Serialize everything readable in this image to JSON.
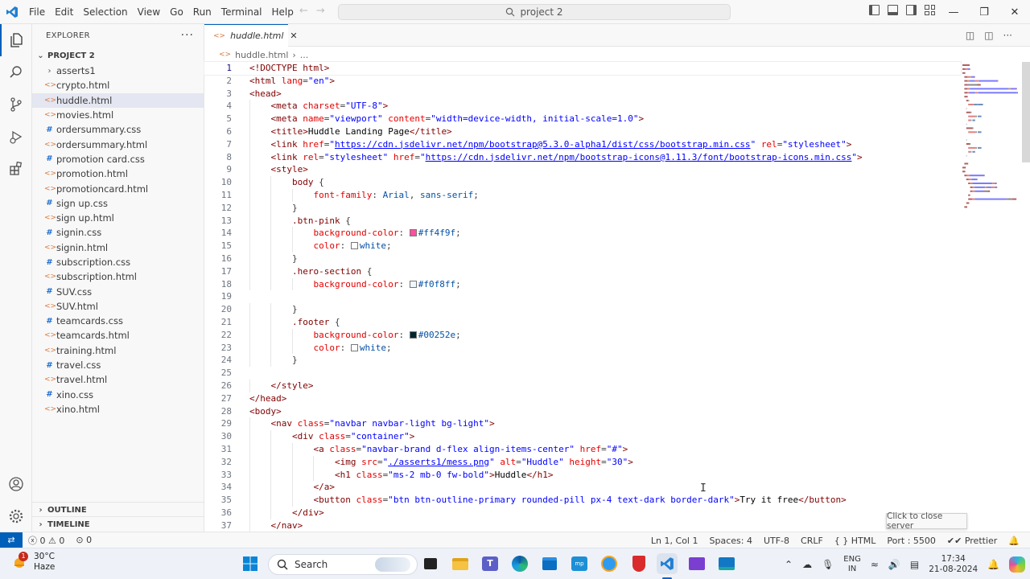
{
  "menu": [
    "File",
    "Edit",
    "Selection",
    "View",
    "Go",
    "Run",
    "Terminal",
    "Help"
  ],
  "command_center": {
    "label": "project 2",
    "icon": "search-icon"
  },
  "explorer": {
    "title": "EXPLORER",
    "more": "···",
    "project": "PROJECT 2",
    "files": [
      {
        "name": "asserts1",
        "kind": "folder"
      },
      {
        "name": "crypto.html",
        "kind": "html"
      },
      {
        "name": "huddle.html",
        "kind": "html",
        "selected": true
      },
      {
        "name": "movies.html",
        "kind": "html"
      },
      {
        "name": "ordersummary.css",
        "kind": "css"
      },
      {
        "name": "ordersummary.html",
        "kind": "html"
      },
      {
        "name": "promotion card.css",
        "kind": "css"
      },
      {
        "name": "promotion.html",
        "kind": "html"
      },
      {
        "name": "promotioncard.html",
        "kind": "html"
      },
      {
        "name": "sign up.css",
        "kind": "css"
      },
      {
        "name": "sign up.html",
        "kind": "html"
      },
      {
        "name": "signin.css",
        "kind": "css"
      },
      {
        "name": "signin.html",
        "kind": "html"
      },
      {
        "name": "subscription.css",
        "kind": "css"
      },
      {
        "name": "subscription.html",
        "kind": "html"
      },
      {
        "name": "SUV.css",
        "kind": "css"
      },
      {
        "name": "SUV.html",
        "kind": "html"
      },
      {
        "name": "teamcards.css",
        "kind": "css"
      },
      {
        "name": "teamcards.html",
        "kind": "html"
      },
      {
        "name": "training.html",
        "kind": "html"
      },
      {
        "name": "travel.css",
        "kind": "css"
      },
      {
        "name": "travel.html",
        "kind": "html"
      },
      {
        "name": "xino.css",
        "kind": "css"
      },
      {
        "name": "xino.html",
        "kind": "html"
      }
    ],
    "outline": "OUTLINE",
    "timeline": "TIMELINE"
  },
  "editor": {
    "tab_label": "huddle.html",
    "breadcrumb_file": "huddle.html",
    "breadcrumb_more": "...",
    "current_line": 1,
    "lines": [
      [
        [
          "tag",
          "<!DOCTYPE html>"
        ]
      ],
      [
        [
          "tag",
          "<html "
        ],
        [
          "attr",
          "lang"
        ],
        [
          "punc",
          "="
        ],
        [
          "val",
          "\"en\""
        ],
        [
          "tag",
          ">"
        ]
      ],
      [
        [
          "tag",
          "<head>"
        ]
      ],
      [
        [
          "sp",
          "    "
        ],
        [
          "tag",
          "<meta "
        ],
        [
          "attr",
          "charset"
        ],
        [
          "punc",
          "="
        ],
        [
          "val",
          "\"UTF-8\""
        ],
        [
          "tag",
          ">"
        ]
      ],
      [
        [
          "sp",
          "    "
        ],
        [
          "tag",
          "<meta "
        ],
        [
          "attr",
          "name"
        ],
        [
          "punc",
          "="
        ],
        [
          "val",
          "\"viewport\""
        ],
        [
          "txt",
          " "
        ],
        [
          "attr",
          "content"
        ],
        [
          "punc",
          "="
        ],
        [
          "val",
          "\"width=device-width, initial-scale=1.0\""
        ],
        [
          "tag",
          ">"
        ]
      ],
      [
        [
          "sp",
          "    "
        ],
        [
          "tag",
          "<title>"
        ],
        [
          "txt",
          "Huddle Landing Page"
        ],
        [
          "tag",
          "</title>"
        ]
      ],
      [
        [
          "sp",
          "    "
        ],
        [
          "tag",
          "<link "
        ],
        [
          "attr",
          "href"
        ],
        [
          "punc",
          "="
        ],
        [
          "val",
          "\""
        ],
        [
          "url",
          "https://cdn.jsdelivr.net/npm/bootstrap@5.3.0-alpha1/dist/css/bootstrap.min.css"
        ],
        [
          "val",
          "\""
        ],
        [
          "txt",
          " "
        ],
        [
          "attr",
          "rel"
        ],
        [
          "punc",
          "="
        ],
        [
          "val",
          "\"stylesheet\""
        ],
        [
          "tag",
          ">"
        ]
      ],
      [
        [
          "sp",
          "    "
        ],
        [
          "tag",
          "<link "
        ],
        [
          "attr",
          "rel"
        ],
        [
          "punc",
          "="
        ],
        [
          "val",
          "\"stylesheet\""
        ],
        [
          "txt",
          " "
        ],
        [
          "attr",
          "href"
        ],
        [
          "punc",
          "="
        ],
        [
          "val",
          "\""
        ],
        [
          "url",
          "https://cdn.jsdelivr.net/npm/bootstrap-icons@1.11.3/font/bootstrap-icons.min.css"
        ],
        [
          "val",
          "\""
        ],
        [
          "tag",
          ">"
        ]
      ],
      [
        [
          "sp",
          "    "
        ],
        [
          "tag",
          "<style>"
        ]
      ],
      [
        [
          "sp",
          "        "
        ],
        [
          "sel",
          "body"
        ],
        [
          "txt",
          " "
        ],
        [
          "punc",
          "{"
        ]
      ],
      [
        [
          "sp",
          "            "
        ],
        [
          "prop",
          "font-family"
        ],
        [
          "punc",
          ": "
        ],
        [
          "num",
          "Arial"
        ],
        [
          "punc",
          ", "
        ],
        [
          "num",
          "sans-serif"
        ],
        [
          "punc",
          ";"
        ]
      ],
      [
        [
          "sp",
          "        "
        ],
        [
          "punc",
          "}"
        ]
      ],
      [
        [
          "sp",
          "        "
        ],
        [
          "sel",
          ".btn-pink"
        ],
        [
          "txt",
          " "
        ],
        [
          "punc",
          "{"
        ]
      ],
      [
        [
          "sp",
          "            "
        ],
        [
          "prop",
          "background-color"
        ],
        [
          "punc",
          ": "
        ],
        [
          "swatch",
          "#ff4f9f"
        ],
        [
          "num",
          "#ff4f9f"
        ],
        [
          "punc",
          ";"
        ]
      ],
      [
        [
          "sp",
          "            "
        ],
        [
          "prop",
          "color"
        ],
        [
          "punc",
          ": "
        ],
        [
          "swatch",
          "#ffffff"
        ],
        [
          "num",
          "white"
        ],
        [
          "punc",
          ";"
        ]
      ],
      [
        [
          "sp",
          "        "
        ],
        [
          "punc",
          "}"
        ]
      ],
      [
        [
          "sp",
          "        "
        ],
        [
          "sel",
          ".hero-section"
        ],
        [
          "txt",
          " "
        ],
        [
          "punc",
          "{"
        ]
      ],
      [
        [
          "sp",
          "            "
        ],
        [
          "prop",
          "background-color"
        ],
        [
          "punc",
          ": "
        ],
        [
          "swatch",
          "#f0f8ff"
        ],
        [
          "num",
          "#f0f8ff"
        ],
        [
          "punc",
          ";"
        ]
      ],
      [
        [
          "sp",
          ""
        ]
      ],
      [
        [
          "sp",
          "        "
        ],
        [
          "punc",
          "}"
        ]
      ],
      [
        [
          "sp",
          "        "
        ],
        [
          "sel",
          ".footer"
        ],
        [
          "txt",
          " "
        ],
        [
          "punc",
          "{"
        ]
      ],
      [
        [
          "sp",
          "            "
        ],
        [
          "prop",
          "background-color"
        ],
        [
          "punc",
          ": "
        ],
        [
          "swatch",
          "#00252e"
        ],
        [
          "num",
          "#00252e"
        ],
        [
          "punc",
          ";"
        ]
      ],
      [
        [
          "sp",
          "            "
        ],
        [
          "prop",
          "color"
        ],
        [
          "punc",
          ": "
        ],
        [
          "swatch",
          "#ffffff"
        ],
        [
          "num",
          "white"
        ],
        [
          "punc",
          ";"
        ]
      ],
      [
        [
          "sp",
          "        "
        ],
        [
          "punc",
          "}"
        ]
      ],
      [
        [
          "sp",
          ""
        ]
      ],
      [
        [
          "sp",
          "    "
        ],
        [
          "tag",
          "</style>"
        ]
      ],
      [
        [
          "tag",
          "</head>"
        ]
      ],
      [
        [
          "tag",
          "<body>"
        ]
      ],
      [
        [
          "sp",
          "    "
        ],
        [
          "tag",
          "<nav "
        ],
        [
          "attr",
          "class"
        ],
        [
          "punc",
          "="
        ],
        [
          "val",
          "\"navbar navbar-light bg-light\""
        ],
        [
          "tag",
          ">"
        ]
      ],
      [
        [
          "sp",
          "        "
        ],
        [
          "tag",
          "<div "
        ],
        [
          "attr",
          "class"
        ],
        [
          "punc",
          "="
        ],
        [
          "val",
          "\"container\""
        ],
        [
          "tag",
          ">"
        ]
      ],
      [
        [
          "sp",
          "            "
        ],
        [
          "tag",
          "<a "
        ],
        [
          "attr",
          "class"
        ],
        [
          "punc",
          "="
        ],
        [
          "val",
          "\"navbar-brand d-flex align-items-center\""
        ],
        [
          "txt",
          " "
        ],
        [
          "attr",
          "href"
        ],
        [
          "punc",
          "="
        ],
        [
          "val",
          "\"#\""
        ],
        [
          "tag",
          ">"
        ]
      ],
      [
        [
          "sp",
          "                "
        ],
        [
          "tag",
          "<img "
        ],
        [
          "attr",
          "src"
        ],
        [
          "punc",
          "="
        ],
        [
          "val",
          "\""
        ],
        [
          "url",
          "./asserts1/mess.png"
        ],
        [
          "val",
          "\""
        ],
        [
          "txt",
          " "
        ],
        [
          "attr",
          "alt"
        ],
        [
          "punc",
          "="
        ],
        [
          "val",
          "\"Huddle\""
        ],
        [
          "txt",
          " "
        ],
        [
          "attr",
          "height"
        ],
        [
          "punc",
          "="
        ],
        [
          "val",
          "\"30\""
        ],
        [
          "tag",
          ">"
        ]
      ],
      [
        [
          "sp",
          "                "
        ],
        [
          "tag",
          "<h1 "
        ],
        [
          "attr",
          "class"
        ],
        [
          "punc",
          "="
        ],
        [
          "val",
          "\"ms-2 mb-0 fw-bold\""
        ],
        [
          "tag",
          ">"
        ],
        [
          "txt",
          "Huddle"
        ],
        [
          "tag",
          "</h1>"
        ]
      ],
      [
        [
          "sp",
          "            "
        ],
        [
          "tag",
          "</a>"
        ]
      ],
      [
        [
          "sp",
          "            "
        ],
        [
          "tag",
          "<button "
        ],
        [
          "attr",
          "class"
        ],
        [
          "punc",
          "="
        ],
        [
          "val",
          "\"btn btn-outline-primary rounded-pill px-4 text-dark border-dark\""
        ],
        [
          "tag",
          ">"
        ],
        [
          "txt",
          "Try it free"
        ],
        [
          "tag",
          "</button>"
        ]
      ],
      [
        [
          "sp",
          "        "
        ],
        [
          "tag",
          "</div>"
        ]
      ],
      [
        [
          "sp",
          "    "
        ],
        [
          "tag",
          "</nav>"
        ]
      ]
    ]
  },
  "statusbar": {
    "errors": "ⓧ 0 ⚠ 0",
    "ports": "⊙ 0",
    "position": "Ln 1, Col 1",
    "spaces": "Spaces: 4",
    "encoding": "UTF-8",
    "eol": "CRLF",
    "language": "{ } HTML",
    "port": "Port : 5500",
    "prettier": "✔✔ Prettier",
    "tooltip": "Click to close server"
  },
  "taskbar": {
    "weather_temp": "30°C",
    "weather_desc": "Haze",
    "weather_badge": "1",
    "search_label": "Search",
    "lang_line1": "ENG",
    "lang_line2": "IN",
    "time": "17:34",
    "date": "21-08-2024"
  },
  "colors": {
    "accent": "#005fb8",
    "tag": "#800000",
    "attr": "#e50000",
    "value": "#0000ff"
  }
}
